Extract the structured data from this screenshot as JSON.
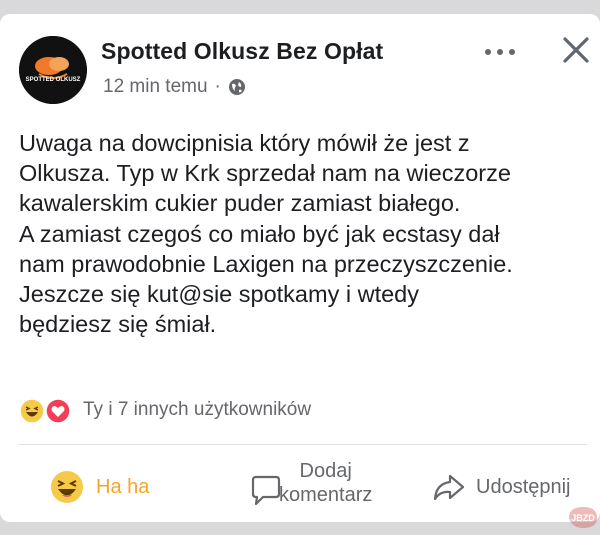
{
  "post": {
    "page_name": "Spotted Olkusz Bez Opłat",
    "avatar_text": "SPOTTED OLKUSZ",
    "time": "12 min temu",
    "separator": "·",
    "body_lines": [
      "Uwaga na dowcipnisia który mówił że jest z",
      "Olkusza. Typ w Krk sprzedał nam na wieczorze",
      "kawalerskim cukier puder zamiast białego.",
      "A zamiast czegoś co miało być jak ecstasy dał",
      "nam prawodobnie Laxigen na przeczyszczenie.",
      "Jeszcze się kut@sie spotkamy i wtedy",
      "będziesz się śmiał."
    ]
  },
  "reactions": {
    "summary": "Ty i 7 innych użytkowników",
    "icons": [
      "haha-reaction-icon",
      "love-reaction-icon"
    ]
  },
  "actions": {
    "haha_label": "Ha ha",
    "comment_label_line1": "Dodaj",
    "comment_label_line2": "komentarz",
    "share_label": "Udostępnij"
  },
  "icons": {
    "more": "more-dots-icon",
    "close": "close-icon",
    "privacy": "globe-icon",
    "comment": "comment-bubble-icon",
    "share": "share-arrow-icon"
  },
  "colors": {
    "haha_active": "#f5a623",
    "text": "#1c1e21",
    "secondary": "#65676b",
    "love": "#f33e58",
    "background": "#d9d9db"
  },
  "watermark": "JBZD"
}
